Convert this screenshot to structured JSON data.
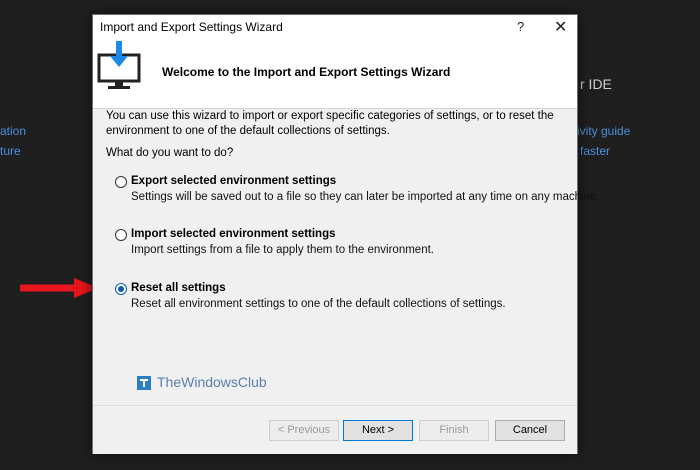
{
  "background": {
    "ide_title_fragment": "r IDE",
    "left_link_1": "ation",
    "left_link_2": "ture",
    "right_link_1": "ivity guide",
    "right_link_2": "faster"
  },
  "dialog": {
    "title": "Import and Export Settings Wizard",
    "help_label": "?",
    "close_label": "✕",
    "header": "Welcome to the Import and Export Settings Wizard",
    "intro": "You can use this wizard to import or export specific categories of settings, or to reset the environment to one of the default collections of settings.",
    "question": "What do you want to do?",
    "options": [
      {
        "label": "Export selected environment settings",
        "desc": "Settings will be saved out to a file so they can later be imported at any time on any machine.",
        "selected": false
      },
      {
        "label": "Import selected environment settings",
        "desc": "Import settings from a file to apply them to the environment.",
        "selected": false
      },
      {
        "label": "Reset all settings",
        "desc": "Reset all environment settings to one of the default collections of settings.",
        "selected": true
      }
    ],
    "buttons": {
      "previous": "< Previous",
      "next": "Next >",
      "finish": "Finish",
      "cancel": "Cancel"
    }
  },
  "watermark": "TheWindowsClub",
  "colors": {
    "arrow": "#e8141c",
    "accent": "#0078d7",
    "link": "#4a90d9"
  }
}
